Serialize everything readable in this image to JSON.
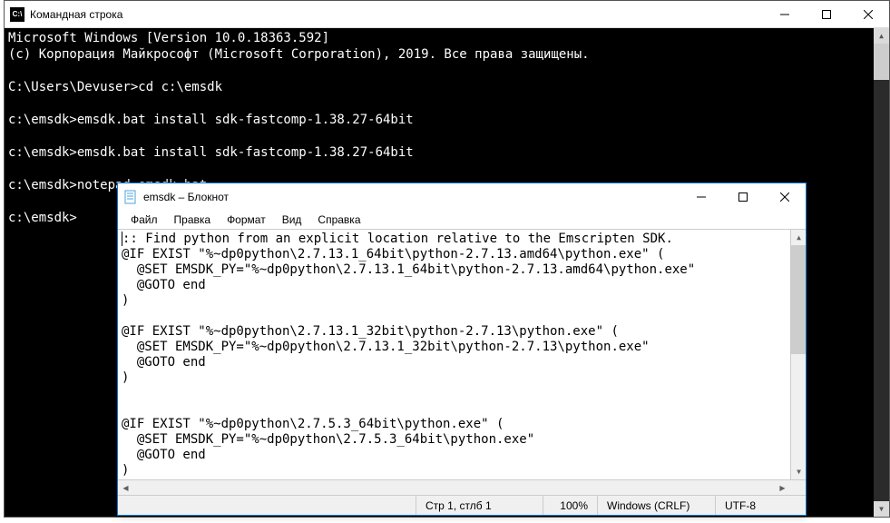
{
  "cmd": {
    "title": "Командная строка",
    "icon_label": "C:\\",
    "lines": [
      "Microsoft Windows [Version 10.0.18363.592]",
      "(c) Корпорация Майкрософт (Microsoft Corporation), 2019. Все права защищены.",
      "",
      "C:\\Users\\Devuser>cd c:\\emsdk",
      "",
      "c:\\emsdk>emsdk.bat install sdk-fastcomp-1.38.27-64bit",
      "",
      "c:\\emsdk>emsdk.bat install sdk-fastcomp-1.38.27-64bit",
      "",
      "c:\\emsdk>notepad emsdk.bat",
      "",
      "c:\\emsdk>"
    ]
  },
  "notepad": {
    "title": "emsdk – Блокнот",
    "menus": [
      "Файл",
      "Правка",
      "Формат",
      "Вид",
      "Справка"
    ],
    "content": ":: Find python from an explicit location relative to the Emscripten SDK.\n@IF EXIST \"%~dp0python\\2.7.13.1_64bit\\python-2.7.13.amd64\\python.exe\" (\n  @SET EMSDK_PY=\"%~dp0python\\2.7.13.1_64bit\\python-2.7.13.amd64\\python.exe\"\n  @GOTO end\n)\n\n@IF EXIST \"%~dp0python\\2.7.13.1_32bit\\python-2.7.13\\python.exe\" (\n  @SET EMSDK_PY=\"%~dp0python\\2.7.13.1_32bit\\python-2.7.13\\python.exe\"\n  @GOTO end\n)\n\n\n@IF EXIST \"%~dp0python\\2.7.5.3_64bit\\python.exe\" (\n  @SET EMSDK_PY=\"%~dp0python\\2.7.5.3_64bit\\python.exe\"\n  @GOTO end\n)",
    "status": {
      "cursor": "Стр 1, стлб 1",
      "zoom": "100%",
      "eol": "Windows (CRLF)",
      "encoding": "UTF-8"
    }
  }
}
